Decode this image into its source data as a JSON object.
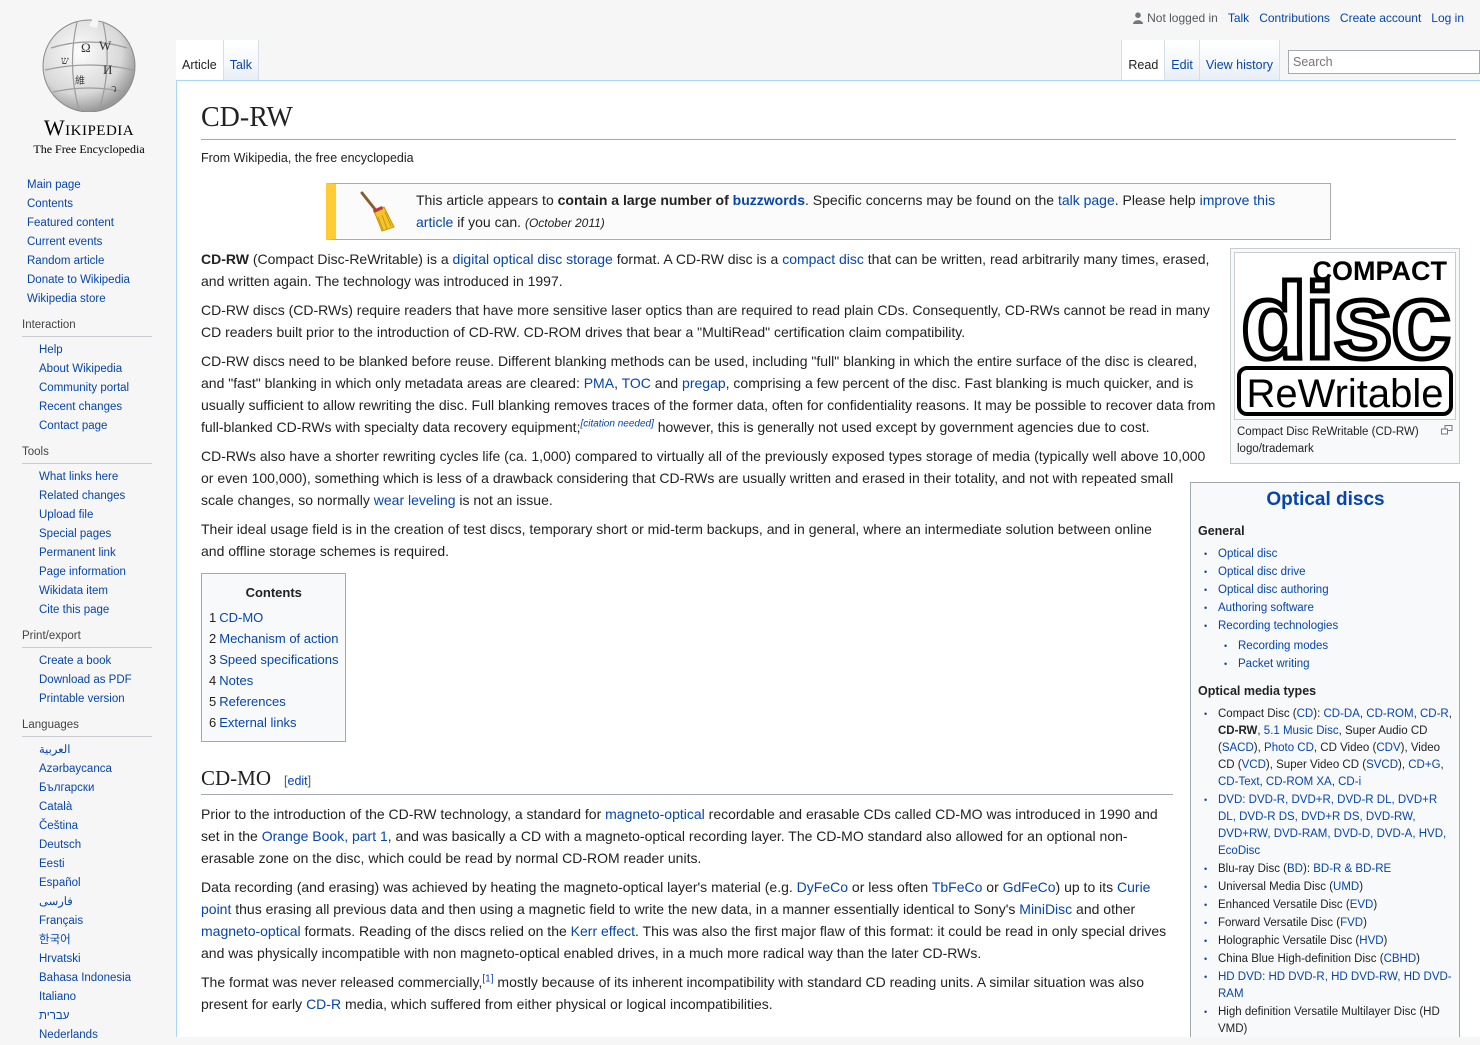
{
  "personal": {
    "not_logged": "Not logged in",
    "talk": "Talk",
    "contributions": "Contributions",
    "create": "Create account",
    "login": "Log in"
  },
  "logo": {
    "wordmark": "Wikipedia",
    "tagline": "The Free Encyclopedia"
  },
  "nav": {
    "main": [
      "Main page",
      "Contents",
      "Featured content",
      "Current events",
      "Random article",
      "Donate to Wikipedia",
      "Wikipedia store"
    ],
    "interaction": {
      "title": "Interaction",
      "items": [
        "Help",
        "About Wikipedia",
        "Community portal",
        "Recent changes",
        "Contact page"
      ]
    },
    "tools": {
      "title": "Tools",
      "items": [
        "What links here",
        "Related changes",
        "Upload file",
        "Special pages",
        "Permanent link",
        "Page information",
        "Wikidata item",
        "Cite this page"
      ]
    },
    "print": {
      "title": "Print/export",
      "items": [
        "Create a book",
        "Download as PDF",
        "Printable version"
      ]
    },
    "languages": {
      "title": "Languages",
      "items": [
        "العربية",
        "Azərbaycanca",
        "Български",
        "Català",
        "Čeština",
        "Deutsch",
        "Eesti",
        "Español",
        "فارسی",
        "Français",
        "한국어",
        "Hrvatski",
        "Bahasa Indonesia",
        "Italiano",
        "עברית",
        "Nederlands"
      ]
    }
  },
  "tabs": {
    "article": "Article",
    "talk": "Talk",
    "read": "Read",
    "edit": "Edit",
    "history": "View history",
    "search_placeholder": "Search"
  },
  "page": {
    "title": "CD-RW",
    "sub": "From Wikipedia, the free encyclopedia"
  },
  "ambox": {
    "t1": "This article appears to ",
    "b1": "contain a large number of ",
    "l1": "buzzwords",
    "t2": ". Specific concerns may be found on the ",
    "l2": "talk page",
    "t3": ". Please help ",
    "l3": "improve this article",
    "t4": " if you can. ",
    "date": "(October 2011)"
  },
  "infobox": {
    "logo_line1": "COMPACT",
    "logo_line2": "disc",
    "logo_line3": "ReWritable",
    "caption": "Compact Disc ReWritable (CD-RW) logo/trademark"
  },
  "navbox": {
    "title": "Optical discs",
    "general": "General",
    "general_items": [
      "Optical disc",
      "Optical disc drive",
      "Optical disc authoring",
      "Authoring software",
      "Recording technologies"
    ],
    "sub_items": [
      "Recording modes",
      "Packet writing"
    ],
    "media": "Optical media types",
    "cd": {
      "pre": "Compact Disc (",
      "cd": "CD",
      "mid": "): ",
      "cdda": "CD-DA",
      "c1": ", ",
      "cdrom": "CD-ROM",
      "c2": ", ",
      "cdr": "CD-R",
      "c3": ", ",
      "cdrw": "CD-RW",
      "c4": ", ",
      "music": "5.1 Music Disc",
      "c5": ", Super Audio CD (",
      "sacd": "SACD",
      "c6": "), ",
      "photo": "Photo CD",
      "c7": ", CD Video (",
      "cdv": "CDV",
      "c8": "), Video CD (",
      "vcd": "VCD",
      "c9": "), Super Video CD (",
      "svcd": "SVCD",
      "c10": "), ",
      "cdg": "CD+G",
      "c11": ", ",
      "cdtext": "CD-Text",
      "c12": ", ",
      "cdromxa": "CD-ROM XA",
      "c13": ", ",
      "cdi": "CD-i"
    },
    "dvd": "DVD: DVD-R, DVD+R, DVD-R DL, DVD+R DL, DVD-R DS, DVD+R DS, DVD-RW, DVD+RW, DVD-RAM, DVD-D, DVD-A, HVD, EcoDisc",
    "bluray": {
      "pre": "Blu-ray Disc (",
      "bd": "BD",
      "mid": "): ",
      "links": "BD-R & BD-RE"
    },
    "others": [
      {
        "pre": "Universal Media Disc (",
        "link": "UMD",
        "post": ")"
      },
      {
        "pre": "Enhanced Versatile Disc (",
        "link": "EVD",
        "post": ")"
      },
      {
        "pre": "Forward Versatile Disc (",
        "link": "FVD",
        "post": ")"
      },
      {
        "pre": "Holographic Versatile Disc (",
        "link": "HVD",
        "post": ")"
      },
      {
        "pre": "China Blue High-definition Disc (",
        "link": "CBHD",
        "post": ")"
      }
    ],
    "hddvd": "HD DVD: HD DVD-R, HD DVD-RW, HD DVD-RAM",
    "hvmd": "High definition Versatile Multilayer Disc (HD VMD)"
  },
  "p1": {
    "b": "CD-RW",
    "t1": " (Compact Disc-ReWritable) is a ",
    "l1": "digital optical disc storage",
    "t2": " format. A CD-RW disc is a ",
    "l2": "compact disc",
    "t3": " that can be written, read arbitrarily many times, erased, and written again. The technology was introduced in 1997."
  },
  "p2": "CD-RW discs (CD-RWs) require readers that have more sensitive laser optics than are required to read plain CDs. Consequently, CD-RWs cannot be read in many CD readers built prior to the introduction of CD-RW. CD-ROM drives that bear a \"MultiRead\" certification claim compatibility.",
  "p3": {
    "t1": "CD-RW discs need to be blanked before reuse. Different blanking methods can be used, including \"full\" blanking in which the entire surface of the disc is cleared, and \"fast\" blanking in which only metadata areas are cleared: ",
    "l1": "PMA",
    "t2": ", ",
    "l2": "TOC",
    "t3": " and ",
    "l3": "pregap",
    "t4": ", comprising a few percent of the disc. Fast blanking is much quicker, and is usually sufficient to allow rewriting the disc. Full blanking removes traces of the former data, often for confidentiality reasons. It may be possible to recover data from full-blanked CD-RWs with specialty data recovery equipment;",
    "cite": "[citation needed]",
    "t5": " however, this is generally not used except by government agencies due to cost."
  },
  "p4": {
    "t1": "CD-RWs also have a shorter rewriting cycles life (ca. 1,000) compared to virtually all of the previously exposed types storage of media (typically well above 10,000 or even 100,000), something which is less of a drawback considering that CD-RWs are usually written and erased in their totality, and not with repeated small scale changes, so normally ",
    "l1": "wear leveling",
    "t2": " is not an issue."
  },
  "p5": "Their ideal usage field is in the creation of test discs, temporary short or mid-term backups, and in general, where an intermediate solution between online and offline storage schemes is required.",
  "toc": {
    "title": "Contents",
    "items": [
      {
        "n": "1",
        "t": "CD-MO"
      },
      {
        "n": "2",
        "t": "Mechanism of action"
      },
      {
        "n": "3",
        "t": "Speed specifications"
      },
      {
        "n": "4",
        "t": "Notes"
      },
      {
        "n": "5",
        "t": "References"
      },
      {
        "n": "6",
        "t": "External links"
      }
    ]
  },
  "sec1": {
    "title": "CD-MO",
    "edit": "edit"
  },
  "p6": {
    "t1": "Prior to the introduction of the CD-RW technology, a standard for ",
    "l1": "magneto-optical",
    "t2": " recordable and erasable CDs called CD-MO was introduced in 1990 and set in the ",
    "l2": "Orange Book, part 1",
    "t3": ", and was basically a CD with a magneto-optical recording layer. The CD-MO standard also allowed for an optional non-erasable zone on the disc, which could be read by normal CD-ROM reader units."
  },
  "p7": {
    "t1": "Data recording (and erasing) was achieved by heating the magneto-optical layer's material (e.g. ",
    "l1": "DyFeCo",
    "t2": " or less often ",
    "l2": "TbFeCo",
    "t3": " or ",
    "l3": "GdFeCo",
    "t4": ") up to its ",
    "l4": "Curie point",
    "t5": " thus erasing all previous data and then using a magnetic field to write the new data, in a manner essentially identical to Sony's ",
    "l5": "MiniDisc",
    "t6": " and other ",
    "l6": "magneto-optical",
    "t7": " formats. Reading of the discs relied on the ",
    "l7": "Kerr effect",
    "t8": ". This was also the first major flaw of this format: it could be read in only special drives and was physically incompatible with non magneto-optical enabled drives, in a much more radical way than the later CD-RWs."
  },
  "p8": {
    "t1": "The format was never released commercially,",
    "ref": "[1]",
    "t2": " mostly because of its inherent incompatibility with standard CD reading units. A similar situation was also present for early ",
    "l1": "CD-R",
    "t2b": " media, which suffered from either physical or logical incompatibilities."
  }
}
